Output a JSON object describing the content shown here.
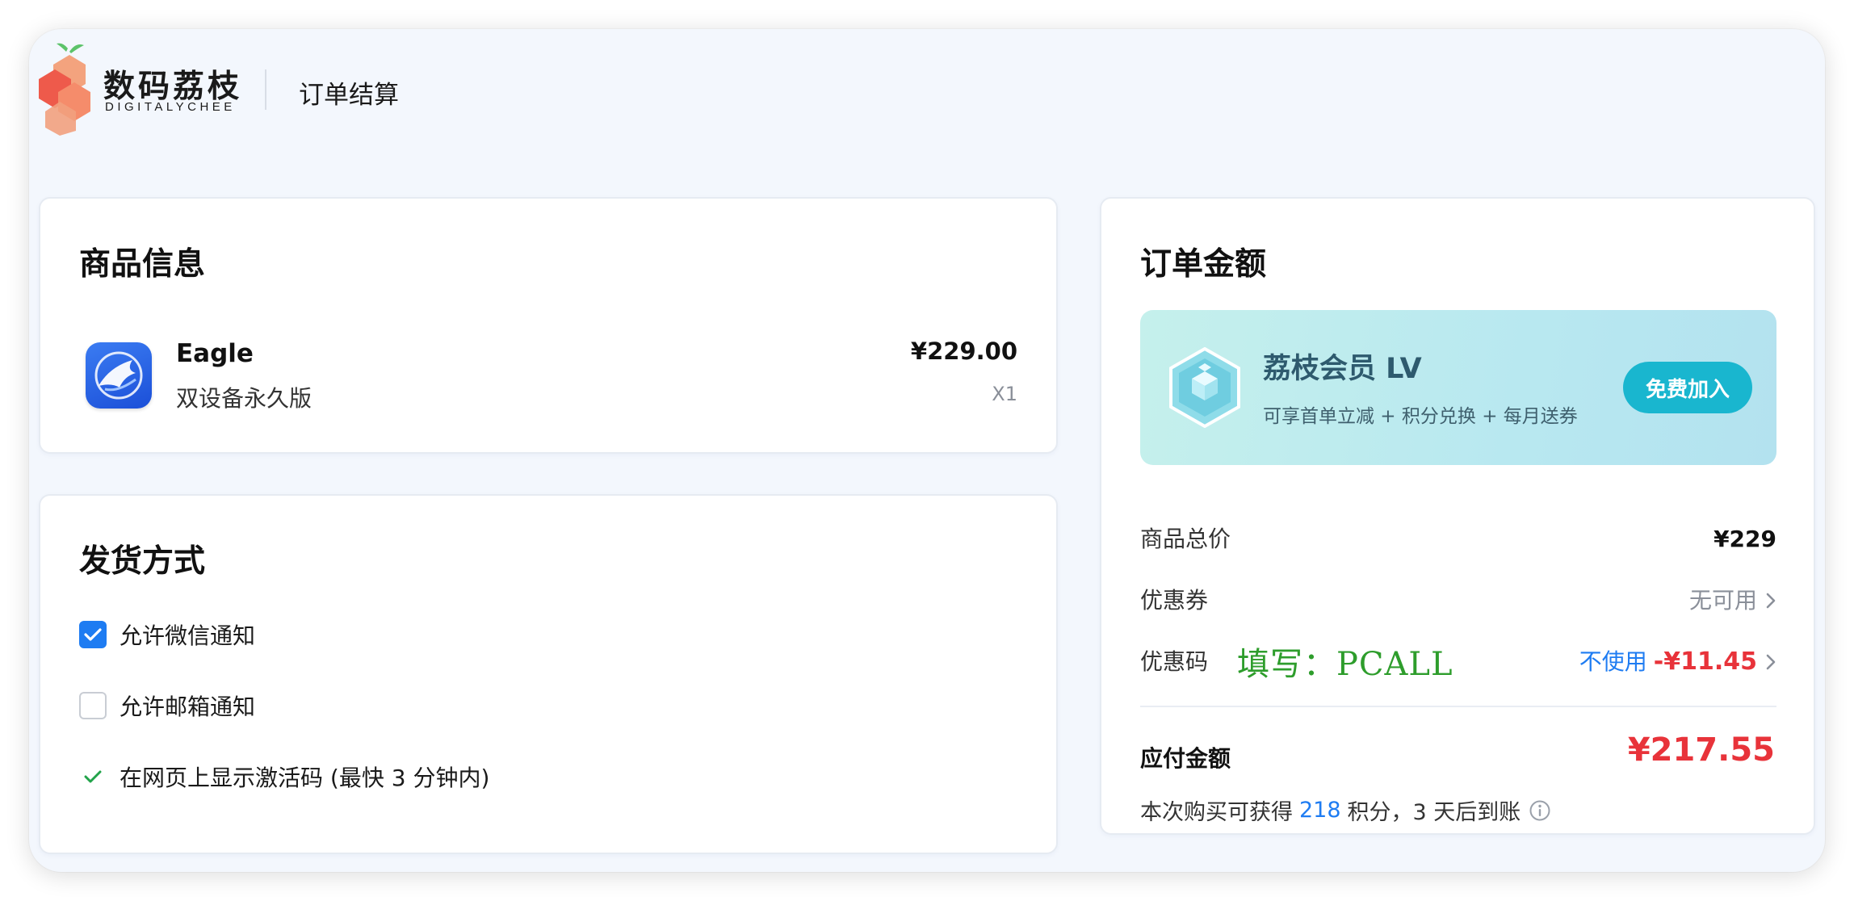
{
  "header": {
    "brand_name": "数码荔枝",
    "brand_sub": "DIGITALYCHEE",
    "page_title": "订单结算"
  },
  "product_card": {
    "title": "商品信息",
    "items": [
      {
        "name": "Eagle",
        "variant": "双设备永久版",
        "price": "¥229.00",
        "qty": "X1",
        "icon": "eagle-app-icon"
      }
    ]
  },
  "delivery_card": {
    "title": "发货方式",
    "options": [
      {
        "label": "允许微信通知",
        "state": "checked"
      },
      {
        "label": "允许邮箱通知",
        "state": "unchecked"
      },
      {
        "label": "在网页上显示激活码 (最快 3 分钟内)",
        "state": "checked-plain"
      }
    ]
  },
  "order_card": {
    "title": "订单金额",
    "vip": {
      "title": "荔枝会员 LV",
      "desc": "可享首单立减 + 积分兑换 + 每月送券",
      "button": "免费加入",
      "icon": "member-cube-icon"
    },
    "rows": {
      "subtotal_label": "商品总价",
      "subtotal_value": "¥229",
      "coupon_label": "优惠券",
      "coupon_value": "无可用",
      "promo_label": "优惠码",
      "promo_note": "填写：PCALL",
      "promo_action": "不使用",
      "promo_discount": "-¥11.45"
    },
    "pay_label": "应付金额",
    "pay_amount": "¥217.55",
    "points": {
      "prefix": "本次购买可获得",
      "value": "218",
      "suffix": "积分，3 天后到账"
    }
  },
  "colors": {
    "accent": "#1e7cf2",
    "price_red": "#e8333a",
    "vip_button": "#19b6cf",
    "promo_green": "#2e9d2c",
    "page_bg": "#f3f7fd"
  }
}
